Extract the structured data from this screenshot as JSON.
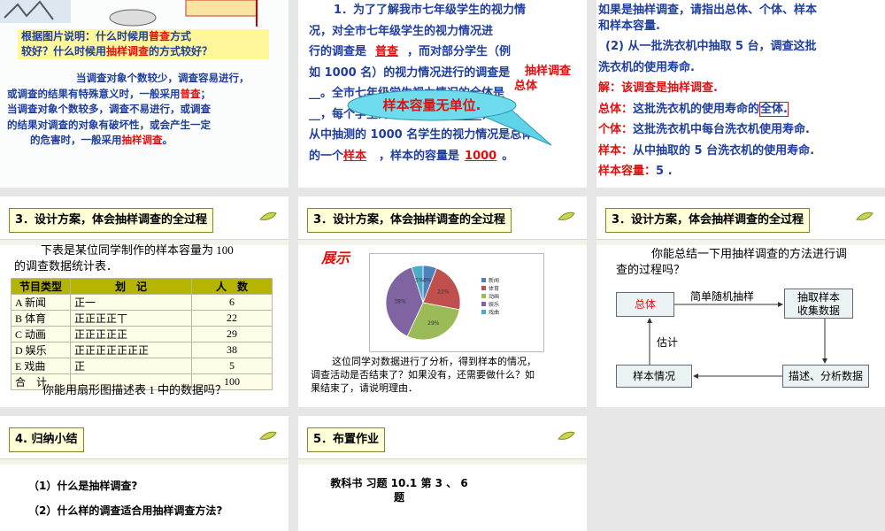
{
  "slide1": {
    "callout": "根据图片说明：什么时候用普查方式较好？什么时候用抽样调查的方式较好？",
    "callout_line1": "根据图片说明：什么时候用",
    "callout_red1": "普查",
    "callout_line1b": "方式",
    "callout_line2a": "较好？什么时候用",
    "callout_red2": "抽样调查",
    "callout_line2b": "的方式较好？",
    "p1a": "当调查对象个数较少，调查容易进行，",
    "p1b": "或调查的结果有特殊意义时，一般采用",
    "p1red": "普查",
    "p1c": "；",
    "p2a": "当调查对象个数较多，调查不易进行，或调查",
    "p2b": "的结果对调查的对象有破坏性，或会产生一定",
    "p2c": "的危害时，一般采用",
    "p2red": "抽样调查",
    "p2d": "。"
  },
  "slide2": {
    "l1": "1．为了了解我市七年级学生的视力情",
    "l2a": "况，对全市七年级学生的视力情况进",
    "l3a": "行的调查是",
    "a1": "普查",
    "l3b": "，而对部分学生（例",
    "l4a": "如 1000 名）的视力情况进行的调查是",
    "a2": "抽样调查",
    "l5": "__。全市七年级学生视力情况的全体是",
    "a3": "总体",
    "l6": "__，每个学生的视力情况是______，",
    "l7": "从中抽测的 1000 名学生的视力情况是总体",
    "l8a": "的一个",
    "a4": "样本",
    "l8b": "，样本的容量是",
    "a5": "1000",
    "l8c": "。",
    "bubble": "样本容量无单位."
  },
  "slide3": {
    "l0": "如果是抽样调查，请指出总体、个体、样本",
    "l0b": "和样本容量.",
    "q": "(2) 从一批洗衣机中抽取 5 台，调查这批",
    "q2": "洗衣机的使用寿命.",
    "ans": "解：该调查是抽样调查.",
    "zt_label": "总体：",
    "zt": "这批洗衣机的使用寿命的",
    "zt_box": "全体.",
    "gt_label": "个体：",
    "gt": "这批洗衣机中每台洗衣机使用寿命.",
    "yb_label": "样本：",
    "yb": "从中抽取的 5 台洗衣机的使用寿命.",
    "rl_label": "样本容量：",
    "rl": "5 ."
  },
  "slide4": {
    "header": "3．设计方案，体会抽样调查的全过程",
    "intro1": "下表是某位同学制作的样本容量为 100",
    "intro2": "的调查数据统计表．",
    "cols": [
      "节目类型",
      "划　记",
      "人　数"
    ],
    "rows": [
      [
        "A  新闻",
        "正一",
        "6"
      ],
      [
        "B  体育",
        "正正正正丅",
        "22"
      ],
      [
        "C  动画",
        "正正正正正",
        "29"
      ],
      [
        "D  娱乐",
        "正正正正正正正",
        "38"
      ],
      [
        "E  戏曲",
        "正",
        "5"
      ],
      [
        "合　计",
        "",
        "100"
      ]
    ],
    "question": "你能用扇形图描述表 1 中的数据吗？"
  },
  "slide5": {
    "header": "3．设计方案，体会抽样调查的全过程",
    "show": "展示",
    "legend": [
      "新闻",
      "体育",
      "动画",
      "娱乐",
      "戏曲"
    ],
    "para1": "这位同学对数据进行了分析，得到样本的情况，",
    "para2": "调查活动是否结束了？如果没有，还需要做什么？如",
    "para3": "果结束了，请说明理由．"
  },
  "slide6": {
    "header": "3．设计方案，体会抽样调查的全过程",
    "q1": "你能总结一下用抽样调查的方法进行调",
    "q2": "查的过程吗？",
    "box_zt": "总体",
    "arrow1": "简单随机抽样",
    "box_cq1": "抽取样本",
    "box_cq2": "收集数据",
    "arrow_gj": "估计",
    "box_yb": "样本情况",
    "box_ms": "描述、分析数据"
  },
  "slide7": {
    "header": "4.  归纳小结",
    "q1": "（1）什么是抽样调查?",
    "q2": "（2）什么样的调查适合用抽样调查方法?"
  },
  "slide8": {
    "header": "5．布置作业",
    "hw1": "教科书  习题 10.1  第 3 、 6",
    "hw2": "题"
  },
  "chart_data": {
    "type": "pie",
    "categories": [
      "新闻",
      "体育",
      "动画",
      "娱乐",
      "戏曲"
    ],
    "values": [
      6,
      22,
      29,
      38,
      5
    ],
    "labels": [
      "6%",
      "22%",
      "29%",
      "38%",
      "5%"
    ],
    "colors": [
      "#4f81bd",
      "#c0504d",
      "#9bbb59",
      "#8064a2",
      "#4bacc6"
    ],
    "legend_position": "right"
  }
}
